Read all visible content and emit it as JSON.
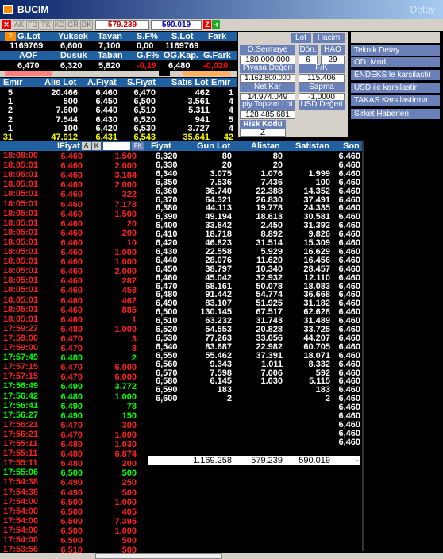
{
  "window": {
    "title": "BUCIM",
    "right_label": "Detay"
  },
  "toolbar": {
    "buttons": [
      "AK",
      "FD",
      "TK",
      "KD",
      "GR",
      "DK"
    ],
    "val1": "579.239",
    "val2": "590.019",
    "z": "Z"
  },
  "summary": {
    "h1": [
      "G.Lot",
      "Yuksek",
      "Tavan",
      "S.F%",
      "S.Lot",
      "Fark"
    ],
    "v1": [
      "1169769",
      "6,600",
      "7,100",
      "0,00",
      "1169769",
      ""
    ],
    "h2": [
      "AOF",
      "Dusuk",
      "Taban",
      "G.F%",
      "OG.Kap.",
      "G.Fark"
    ],
    "v2": [
      "6,470",
      "6,320",
      "5,820",
      "-0,19",
      "6,480",
      "-0,020"
    ]
  },
  "info_panel": {
    "lot_label": "Lot",
    "hacim_label": "Hacim",
    "osermaye_label": "O.Sermaye",
    "osermaye": "180.000.000",
    "don_label": "Dön.",
    "don": "6",
    "hao_label": "HAO",
    "hao": "29",
    "piyasa_label": "Piyasa Değeri",
    "piyasa": "1.162.800.000",
    "fk_label": "F/K",
    "fk": "115.406",
    "netkar_label": "Net Kar",
    "netkar": "14.974.049",
    "sapma_label": "Sapma",
    "sapma": "-1,0000",
    "piyToplam_label": "piy.Toplam Lot",
    "piyToplam": "128.485.681",
    "usd_label": "USD Değeri",
    "risk_label": "Risk Kodu",
    "risk": "Z"
  },
  "menu": [
    "Teknik Detay",
    "OD. Mod.",
    "ENDEKS le karsilastir",
    "USD ile karsilastir",
    "TAKAS Karsilastirma",
    "Sirket Haberleri"
  ],
  "depth": {
    "headers": [
      "Emir",
      "Alis Lot",
      "A.Fiyat",
      "S.Fiyat",
      "Satis Lot",
      "Emir"
    ],
    "rows": [
      [
        "5",
        "20.466",
        "6,460",
        "6,470",
        "462",
        "1"
      ],
      [
        "1",
        "500",
        "6,450",
        "6,500",
        "3.561",
        "4"
      ],
      [
        "2",
        "7.600",
        "6,440",
        "6,510",
        "5.311",
        "4"
      ],
      [
        "2",
        "7.544",
        "6,430",
        "6,520",
        "941",
        "5"
      ],
      [
        "1",
        "100",
        "6,420",
        "6,530",
        "3.727",
        "4"
      ]
    ],
    "totals": [
      "31",
      "47.912",
      "6,431",
      "6,543",
      "35.641",
      "42"
    ]
  },
  "trades": {
    "headers": [
      "IFiyat",
      "A",
      "K",
      "",
      "FK"
    ],
    "rows": [
      [
        "18:08:00",
        "6,460",
        "1.500",
        "r"
      ],
      [
        "18:05:01",
        "6,460",
        "2.000",
        "r"
      ],
      [
        "18:05:01",
        "6,460",
        "3.184",
        "r"
      ],
      [
        "18:05:01",
        "6,460",
        "2.000",
        "r"
      ],
      [
        "18:05:01",
        "6,460",
        "322",
        "r"
      ],
      [
        "18:05:01",
        "6,460",
        "7.178",
        "r"
      ],
      [
        "18:05:01",
        "6,460",
        "1.500",
        "r"
      ],
      [
        "18:05:01",
        "6,460",
        "20",
        "r"
      ],
      [
        "18:05:01",
        "6,460",
        "200",
        "r"
      ],
      [
        "18:05:01",
        "6,460",
        "10",
        "r"
      ],
      [
        "18:05:01",
        "6,460",
        "1.000",
        "r"
      ],
      [
        "18:05:01",
        "6,460",
        "1.000",
        "r"
      ],
      [
        "18:05:01",
        "6,460",
        "2.000",
        "r"
      ],
      [
        "18:05:01",
        "6,460",
        "287",
        "r"
      ],
      [
        "18:05:01",
        "6,460",
        "458",
        "r"
      ],
      [
        "18:05:01",
        "6,460",
        "462",
        "r"
      ],
      [
        "18:05:01",
        "6,460",
        "885",
        "r"
      ],
      [
        "18:05:01",
        "6,460",
        "1",
        "r"
      ],
      [
        "17:59:27",
        "6,480",
        "1.000",
        "r"
      ],
      [
        "17:59:00",
        "6,470",
        "3",
        "r"
      ],
      [
        "17:59:00",
        "6,470",
        "3",
        "r"
      ],
      [
        "17:57:49",
        "6,480",
        "2",
        "g"
      ],
      [
        "17:57:15",
        "6,470",
        "6.000",
        "r"
      ],
      [
        "17:57:15",
        "6,470",
        "6.000",
        "r"
      ],
      [
        "17:56:49",
        "6,490",
        "3.772",
        "g"
      ],
      [
        "17:56:42",
        "6,480",
        "1.000",
        "g"
      ],
      [
        "17:56:41",
        "6,490",
        "78",
        "g"
      ],
      [
        "17:56:27",
        "6,490",
        "150",
        "g"
      ],
      [
        "17:56:21",
        "6,470",
        "300",
        "r"
      ],
      [
        "17:56:21",
        "6,470",
        "1.000",
        "r"
      ],
      [
        "17:55:11",
        "6,480",
        "1.030",
        "r"
      ],
      [
        "17:55:11",
        "6,480",
        "6.874",
        "r"
      ],
      [
        "17:55:11",
        "6,480",
        "200",
        "r"
      ],
      [
        "17:55:06",
        "6,500",
        "500",
        "g"
      ],
      [
        "17:54:38",
        "6,490",
        "250",
        "r"
      ],
      [
        "17:54:38",
        "6,490",
        "500",
        "r"
      ],
      [
        "17:54:00",
        "6,500",
        "1.000",
        "r"
      ],
      [
        "17:54:00",
        "6,500",
        "405",
        "r"
      ],
      [
        "17:54:00",
        "6,500",
        "7.395",
        "r"
      ],
      [
        "17:54:00",
        "6,500",
        "1.000",
        "r"
      ],
      [
        "17:54:00",
        "6,500",
        "500",
        "r"
      ],
      [
        "17:53:56",
        "6,510",
        "500",
        "r"
      ]
    ]
  },
  "price_table": {
    "headers": [
      "Fiyat",
      "Gun Lot",
      "Alistan",
      "Satistan",
      "Son"
    ],
    "rows": [
      [
        "6,320",
        "80",
        "80",
        "",
        "6,460"
      ],
      [
        "6,330",
        "20",
        "20",
        "",
        "6,460"
      ],
      [
        "6,340",
        "3.075",
        "1.076",
        "1.999",
        "6,460"
      ],
      [
        "6,350",
        "7.536",
        "7.436",
        "100",
        "6,460"
      ],
      [
        "6,360",
        "36.740",
        "22.388",
        "14.352",
        "6,460"
      ],
      [
        "6,370",
        "64.321",
        "26.830",
        "37.491",
        "6,460"
      ],
      [
        "6,380",
        "44.113",
        "19.778",
        "24.335",
        "6,460"
      ],
      [
        "6,390",
        "49.194",
        "18.613",
        "30.581",
        "6,460"
      ],
      [
        "6,400",
        "33.842",
        "2.450",
        "31.392",
        "6,460"
      ],
      [
        "6,410",
        "18.718",
        "8.892",
        "9.826",
        "6,460"
      ],
      [
        "6,420",
        "46.823",
        "31.514",
        "15.309",
        "6,460"
      ],
      [
        "6,430",
        "22.558",
        "5.929",
        "16.629",
        "6,460"
      ],
      [
        "6,440",
        "28.076",
        "11.620",
        "16.456",
        "6,460"
      ],
      [
        "6,450",
        "38.797",
        "10.340",
        "28.457",
        "6,460"
      ],
      [
        "6,460",
        "45.042",
        "32.932",
        "12.110",
        "6,460"
      ],
      [
        "6,470",
        "68.161",
        "50.078",
        "18.083",
        "6,460"
      ],
      [
        "6,480",
        "91.442",
        "54.774",
        "36.668",
        "6,460"
      ],
      [
        "6,490",
        "83.107",
        "51.925",
        "31.182",
        "6,460"
      ],
      [
        "6,500",
        "130.145",
        "67.517",
        "62.628",
        "6,460"
      ],
      [
        "6,510",
        "63.232",
        "31.743",
        "31.489",
        "6,460"
      ],
      [
        "6,520",
        "54.553",
        "20.828",
        "33.725",
        "6,460"
      ],
      [
        "6,530",
        "77.263",
        "33.056",
        "44.207",
        "6,460"
      ],
      [
        "6,540",
        "83.687",
        "22.982",
        "60.705",
        "6,460"
      ],
      [
        "6,550",
        "55.462",
        "37.391",
        "18.071",
        "6,460"
      ],
      [
        "6,560",
        "9.343",
        "1.011",
        "8.332",
        "6,460"
      ],
      [
        "6,570",
        "7.598",
        "7.006",
        "592",
        "6,460"
      ],
      [
        "6,580",
        "6.145",
        "1.030",
        "5.115",
        "6,460"
      ],
      [
        "6,590",
        "183",
        "",
        "183",
        "6,460"
      ],
      [
        "6,600",
        "2",
        "",
        "2",
        "6,460"
      ],
      [
        "",
        "",
        "",
        "",
        "6,460"
      ],
      [
        "",
        "",
        "",
        "",
        "6,460"
      ],
      [
        "",
        "",
        "",
        "",
        "6,460"
      ],
      [
        "",
        "",
        "",
        "",
        "6,460"
      ],
      [
        "",
        "",
        "",
        "",
        "6,460"
      ]
    ],
    "totals": [
      "",
      "1.169.258",
      "579.239",
      "590.019",
      "-"
    ]
  }
}
